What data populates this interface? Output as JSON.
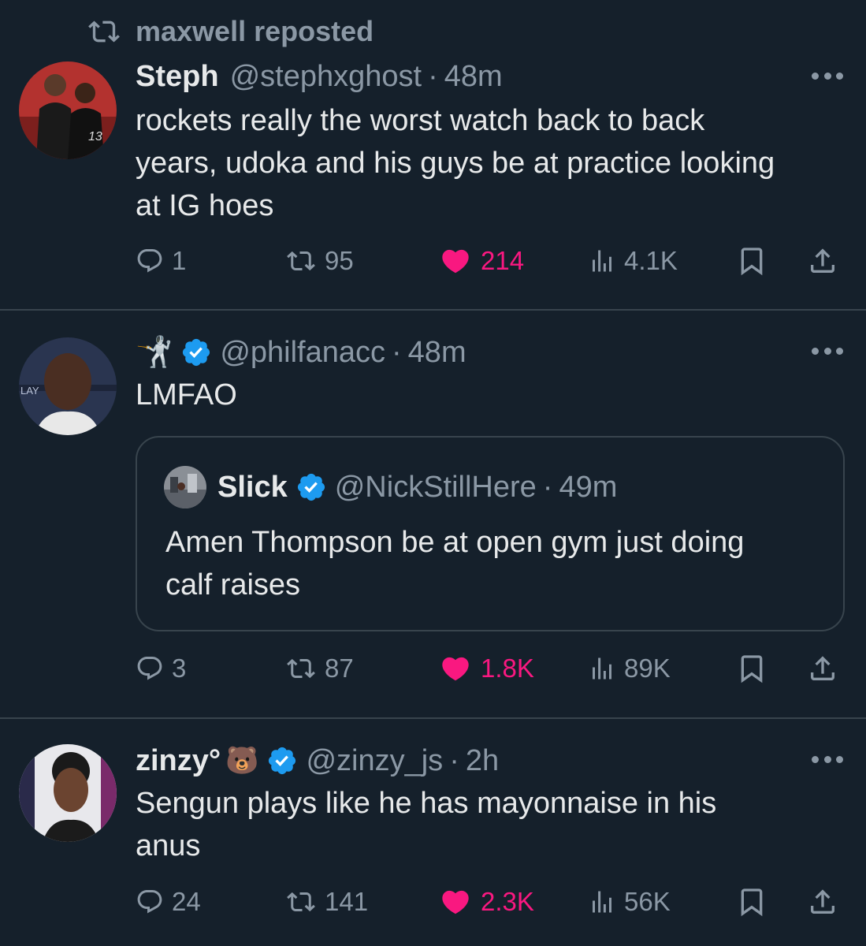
{
  "repost_context": {
    "text": "maxwell reposted"
  },
  "tweets": [
    {
      "name": "Steph",
      "handle": "@stephxghost",
      "time": "48m",
      "lines": [
        "rockets really the worst watch back to back",
        "years, udoka and his guys be at practice looking",
        "at IG hoes"
      ],
      "replies": "1",
      "reposts": "95",
      "likes": "214",
      "views": "4.1K"
    },
    {
      "name_emoji": "🤺",
      "handle": "@philfanacc",
      "time": "48m",
      "lines": [
        "LMFAO"
      ],
      "quote": {
        "name": "Slick",
        "handle": "@NickStillHere",
        "time": "49m",
        "lines": [
          "Amen Thompson be at open gym just doing",
          "calf raises"
        ]
      },
      "replies": "3",
      "reposts": "87",
      "likes": "1.8K",
      "views": "89K"
    },
    {
      "name": "zinzy°",
      "name_emoji": "🐻",
      "handle": "@zinzy_js",
      "time": "2h",
      "lines": [
        "Sengun plays like he has mayonnaise in his",
        "anus"
      ],
      "replies": "24",
      "reposts": "141",
      "likes": "2.3K",
      "views": "56K"
    }
  ],
  "dot_separator": "·",
  "colors": {
    "background": "#15202b",
    "text": "#e7e9ea",
    "muted": "#8b98a5",
    "like": "#f91880",
    "verified": "#1d9bf0",
    "divider": "#38444d"
  },
  "icons": [
    "repost-icon",
    "reply-icon",
    "like-icon",
    "views-icon",
    "bookmark-icon",
    "share-icon",
    "more-icon",
    "verified-badge-icon"
  ]
}
